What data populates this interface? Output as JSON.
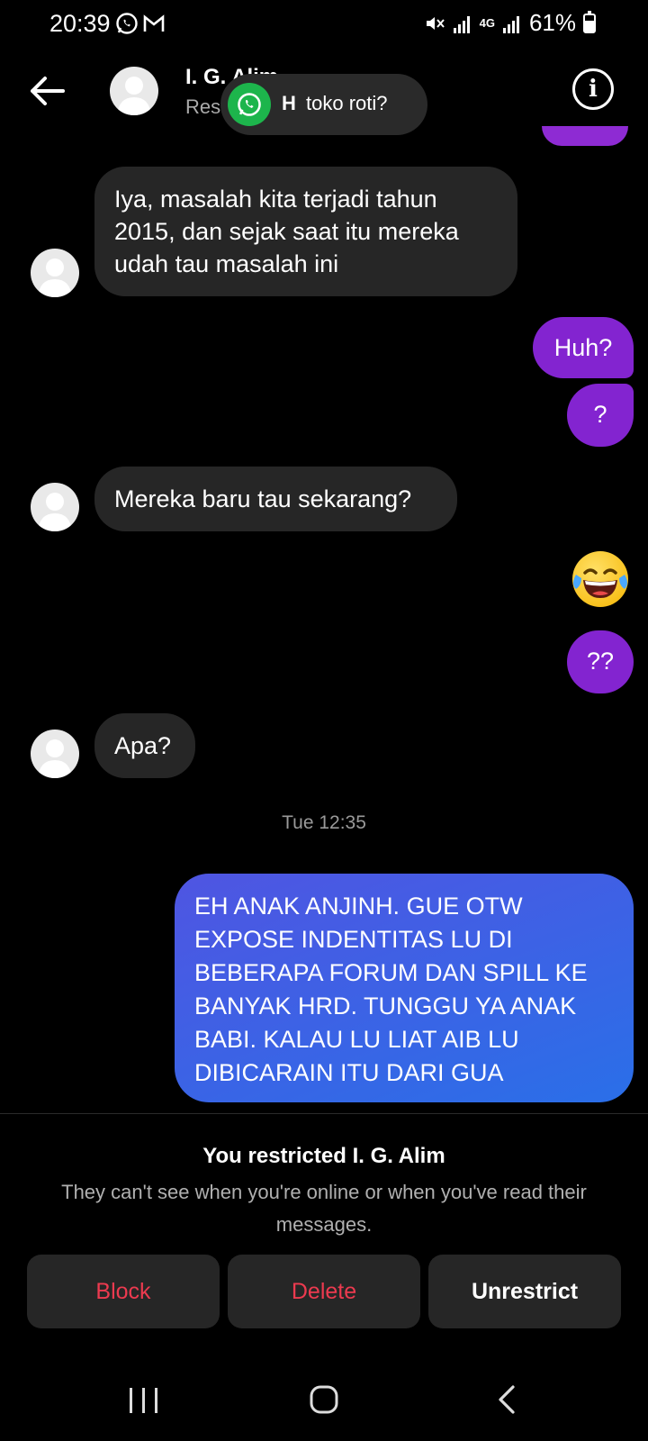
{
  "status_bar": {
    "time": "20:39",
    "battery": "61%",
    "network": "4G"
  },
  "header": {
    "name": "I. G. Alim",
    "subtitle": "Res"
  },
  "notification": {
    "sender_initial": "H",
    "text": "toko roti?"
  },
  "messages": [
    {
      "direction": "in",
      "text": "Iya, masalah kita terjadi tahun 2015, dan sejak saat itu mereka udah tau masalah ini"
    },
    {
      "direction": "out",
      "text": "Huh?"
    },
    {
      "direction": "out",
      "text": "?"
    },
    {
      "direction": "in",
      "text": "Mereka baru tau sekarang?"
    },
    {
      "direction": "out",
      "type": "emoji",
      "text": "😂"
    },
    {
      "direction": "out",
      "text": "??"
    },
    {
      "direction": "in",
      "text": "Apa?"
    },
    {
      "type": "timestamp",
      "text": "Tue 12:35"
    },
    {
      "direction": "out",
      "text": "EH ANAK ANJINH. GUE OTW EXPOSE INDENTITAS LU DI BEBERAPA FORUM DAN SPILL KE BANYAK HRD. TUNGGU YA ANAK BABI. KALAU LU LIAT AIB LU DIBICARAIN ITU DARI GUA"
    }
  ],
  "restriction": {
    "title": "You restricted I. G. Alim",
    "description": "They can't see when you're online or when you've read their messages.",
    "actions": [
      "Block",
      "Delete",
      "Unrestrict"
    ]
  },
  "colors": {
    "incoming": "#262626",
    "outgoing": "#8324d0",
    "outgoing_gradient_end": "#2a6fe8",
    "danger": "#ec3a4f"
  }
}
